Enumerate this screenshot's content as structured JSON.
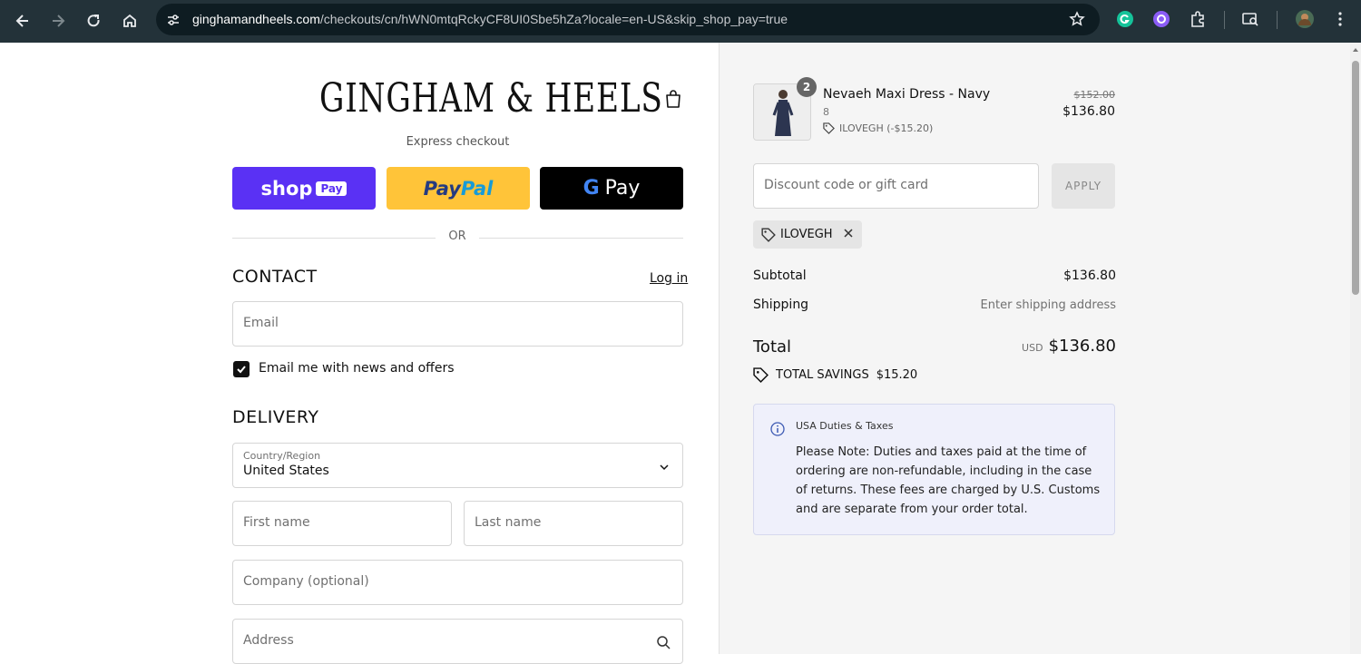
{
  "browser": {
    "url_host": "ginghamandheels.com",
    "url_path": "/checkouts/cn/hWN0mtqRckyCF8UI0Sbe5hZa?locale=en-US&skip_shop_pay=true"
  },
  "header": {
    "logo_text": "GINGHAM & HEELS"
  },
  "express": {
    "label": "Express checkout",
    "shop_pay_text": "shop",
    "shop_pay_tag": "Pay",
    "paypal_1": "Pay",
    "paypal_2": "Pal",
    "gpay_g": "G",
    "gpay_text": "Pay",
    "or_text": "OR"
  },
  "contact": {
    "title": "CONTACT",
    "login": "Log in",
    "email_placeholder": "Email",
    "newsletter_label": "Email me with news and offers",
    "newsletter_checked": true
  },
  "delivery": {
    "title": "DELIVERY",
    "country_label": "Country/Region",
    "country_value": "United States",
    "first_name": "First name",
    "last_name": "Last name",
    "company": "Company (optional)",
    "address": "Address"
  },
  "summary": {
    "product": {
      "name": "Nevaeh Maxi Dress - Navy",
      "variant": "8",
      "quantity": "2",
      "discount": "ILOVEGH (-$15.20)",
      "original_price": "$152.00",
      "price": "$136.80"
    },
    "discount_placeholder": "Discount code or gift card",
    "apply": "APPLY",
    "applied_code": "ILOVEGH",
    "subtotal_label": "Subtotal",
    "subtotal_value": "$136.80",
    "shipping_label": "Shipping",
    "shipping_value": "Enter shipping address",
    "total_label": "Total",
    "total_currency": "USD",
    "total_value": "$136.80",
    "savings_label": "TOTAL SAVINGS",
    "savings_value": "$15.20",
    "notice_title": "USA Duties & Taxes",
    "notice_body": "Please Note: Duties and taxes paid at the time of ordering are non-refundable, including in the case of returns. These fees are charged by U.S. Customs and are separate from your order total."
  },
  "colors": {
    "chrome_bg": "#233239",
    "shop_pay": "#5a31f4",
    "paypal": "#ffc439",
    "gpay": "#000000",
    "notice_bg": "#eff0fb"
  }
}
